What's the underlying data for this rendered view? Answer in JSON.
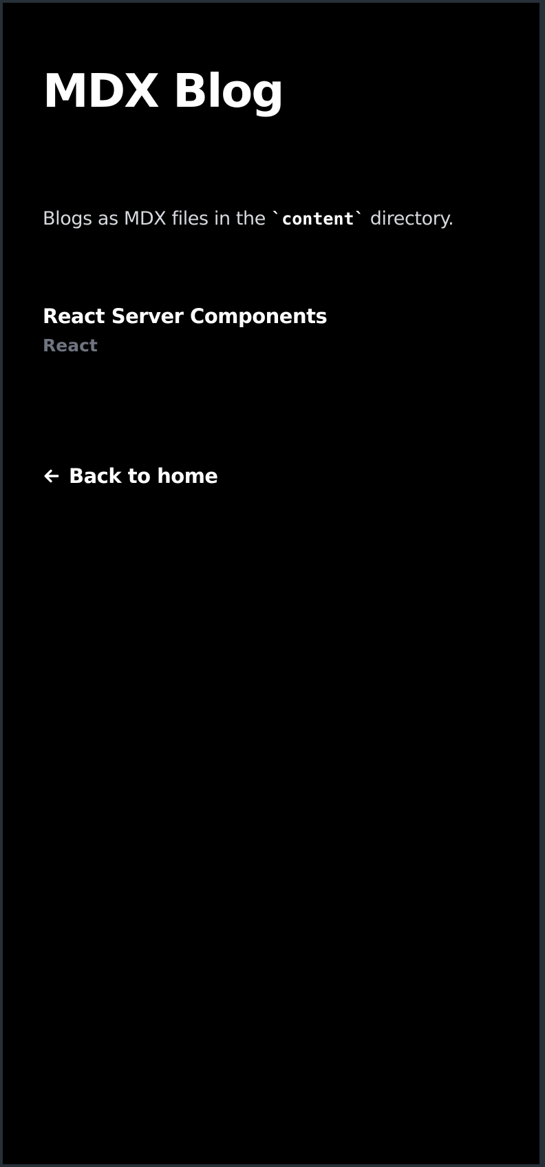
{
  "header": {
    "title": "MDX Blog"
  },
  "intro": {
    "before": "Blogs as MDX files in the ",
    "code": "`content`",
    "after": " directory."
  },
  "posts": [
    {
      "title": "React Server Components",
      "tag": "React"
    }
  ],
  "footer": {
    "back_label": "Back to home",
    "back_icon": "arrow-left-icon"
  },
  "colors": {
    "background": "#000000",
    "frame_border": "#273038",
    "title": "#ffffff",
    "body_text": "#d7d9de",
    "tag_text": "#6f7480"
  }
}
